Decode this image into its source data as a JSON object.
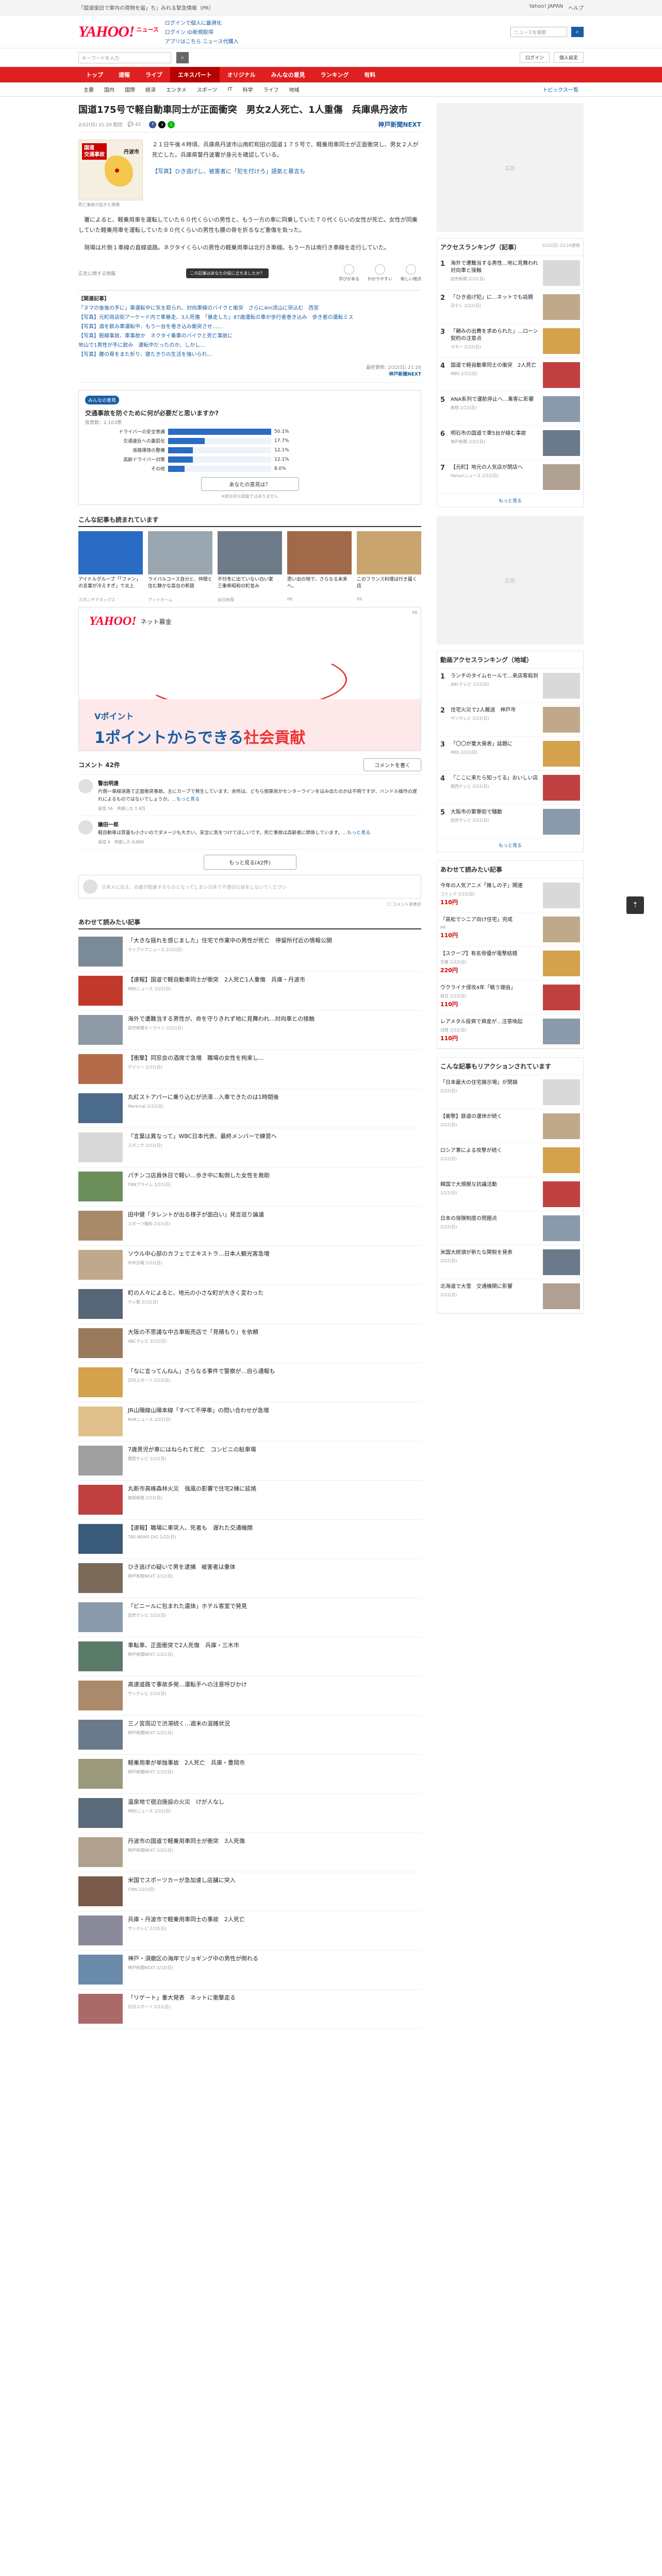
{
  "topbar": {
    "notice": "「国道復旧で車内の荷物を届」ち」みれる緊急情報（PR）",
    "right_links": [
      "Yahoo! JAPAN",
      "ヘルプ"
    ]
  },
  "header": {
    "logo": "YAHOO!",
    "logo_sub": "ニュース",
    "links": [
      "ログインで個人に最適化",
      "ログイン",
      "ID新規取得",
      "アプリはこちら",
      "ニュース代購入"
    ],
    "search_placeholder": "ニュースを検索"
  },
  "subrow": {
    "search_placeholder": "キーワードを入力",
    "buttons": [
      "ログイン",
      "個人設定"
    ]
  },
  "nav": {
    "items": [
      "トップ",
      "速報",
      "ライブ",
      "エキスパート",
      "オリジナル",
      "みんなの意見",
      "ランキング",
      "有料"
    ],
    "active": 3
  },
  "subnav": {
    "items": [
      "主要",
      "国内",
      "国際",
      "経済",
      "エンタメ",
      "スポーツ",
      "IT",
      "科学",
      "ライフ",
      "地域"
    ],
    "more": "トピックス一覧"
  },
  "article": {
    "title": "国道175号で軽自動車同士が正面衝突　男女2人死亡、1人重傷　兵庫県丹波市",
    "date": "2/22(日) 21:20 配信",
    "comments_meta": "42",
    "source": "神戸新聞NEXT",
    "thumb_badge": "国道\n交通事故",
    "thumb_place": "丹波市",
    "thumb_caption": "死亡事故が起きた現場",
    "lead": "２１日午後４時頃、兵庫県丹波市山南町和田の国道１７５号で、軽乗用車同士が正面衝突し、男女２人が死亡した。兵庫県警丹波署が身元を確認している。",
    "lead_link": "【写真】ひき逃げし、被害者に「犯を付けろ」語氣と暴言も",
    "p1": "署によると、軽乗用車を運転していた６０代くらいの男性と、もう一方の車に同乗していた７０代くらいの女性が死亡。女性が同乗していた軽乗用車を運転していた８０代くらいの男性も腰の骨を折るなど重傷を負った。",
    "p2": "現場は片側１車線の直線道路。ネクタイくらいの男性の軽乗用車は北行き車線。もう一方は南行き車線を走行していた。",
    "related_head": "【関連記事】",
    "related": [
      "「ヌマの後後の手に」車運転中に気を取られ、対向車線のバイクと衝突　さらに4ｍ流山に突込む　西宮",
      "【写真】元町商店街アーケード内で車暴走、3人死傷　「暴走した」87歳運転の車が歩行者巻き込み　歩き者の運転ミス",
      "【写真】酒を飲み車運転中、もう一台を巻き込み衝突させ……",
      "【写真】脱線事故、車事故か　ネクタイ乗車のバイクと死亡事故に",
      "地山で1男性が手に飲み　運転中だったのか、しかし…",
      "【写真】腰の骨をまた折り、寝たきりの生活を強いられ…"
    ],
    "copyright": "最終更新: 2/22(日) 21:20",
    "copyright_source": "神戸新聞NEXT"
  },
  "reactions": {
    "tooltip": "この記事はあなたの役に立ちましたか？",
    "items": [
      "学びがある",
      "わかりやすい",
      "新しい視点"
    ],
    "ad_note": "広告に関する情報"
  },
  "poll": {
    "tag": "みんなの意見",
    "question": "交通事故を防ぐために何が必要だと思いますか?",
    "sub": "投票数：2,103票",
    "options": [
      {
        "label": "ドライバーの安全意識",
        "pct": "50.1%",
        "value": 50.1
      },
      {
        "label": "交通違反への厳罰化",
        "pct": "17.7%",
        "value": 17.7
      },
      {
        "label": "道路環境の整備",
        "pct": "12.1%",
        "value": 12.1
      },
      {
        "label": "高齢ドライバー対策",
        "pct": "12.1%",
        "value": 12.1
      },
      {
        "label": "その他",
        "pct": "8.0%",
        "value": 8.0
      }
    ],
    "vote": "あなたの意見は？",
    "note": "※統計的な調査ではありません"
  },
  "recs": {
    "title": "こんな記事も読まれています",
    "items": [
      {
        "t": "アイドルグループ「「ファン」の言葉が冷えすぎ」で炎上",
        "s": "スポニチアネックス"
      },
      {
        "t": "ライバルコース自分と、仲間と住む静かな高台の新居",
        "s": "アットホーム"
      },
      {
        "t": "不付冬に出ていない白い家　三重県昭和の町並み",
        "s": "毎日新聞"
      },
      {
        "t": "思い出の地で、さらなる未来へ。",
        "s": "PR"
      },
      {
        "t": "このフランス料理は行き届く店",
        "s": "PR"
      }
    ]
  },
  "banner": {
    "ylogo": "YAHOO!",
    "bokin": "ネット募金",
    "ad": "PR",
    "line1": "Vポイント",
    "line2": "1ポイントからできる",
    "line2b": "社会貢献"
  },
  "comments": {
    "count": "コメント 42件",
    "write": "コメントを書く",
    "items": [
      {
        "name": "警出明遠",
        "text": "片側一車線道路で正面衝突事故。主にカーブで発生しています。余所は、どちら側車両がセンターラインをはみ出たのかは不明ですが、ハンドル操作の遅れによるものではないでしょうか。",
        "more": "…もっと見る",
        "acts": "返信 16　共感した 1.4万"
      },
      {
        "name": "鎌田一郎",
        "text": "軽自動車は質量も小さいのでダメージも大きい。安全に気をつけてほしいです。死亡事故は高齢者に関係しています。",
        "more": "…もっと見る",
        "acts": "返信 4　共感した 6,800"
      }
    ],
    "more_button": "もっと見る(42件)",
    "post_placeholder": "日本人に伝え、自粛が配慮するものとなってしまい日本で不適切な話をしないでください",
    "checkbox": "コメント非表示"
  },
  "more_list": {
    "title": "あわせて読みたい記事",
    "items": [
      {
        "t": "「大きな揺れを感じました」住宅で作業中の男性が死亡　停留所付近の情報公開",
        "s": "ライブドアニュース 2/22(日)"
      },
      {
        "t": "【速報】国道で軽自動車同士が衝突　2人死亡1人重傷　兵庫・丹波市",
        "s": "MBSニュース 2/22(日)"
      },
      {
        "t": "海外で遭難当する男性が、命を守りきれず地に見舞われ…対向車との接触",
        "s": "読売新聞オンライン 2/22(日)"
      },
      {
        "t": "【衝撃】同窓会の酒席で急増　職場の女性を拘束し…",
        "s": "デイリー 2/22(日)"
      },
      {
        "t": "丸紅ストアパーに乗り込むが渋滞…入車できたのは1時間後",
        "s": "Merkmal 2/22(日)"
      },
      {
        "t": "「言葉は異なって」WBC日本代表、最終メンバーで練習へ",
        "s": "スポニチ 2/22(日)"
      },
      {
        "t": "パチンコ店員休日で軽い…歩き中に転倒した女性を救助",
        "s": "FNNプライム 2/22(日)"
      },
      {
        "t": "田中健「タレントが出る様子が面白い」発言巡り論議",
        "s": "スポーツ報知 2/22(日)"
      },
      {
        "t": "ソウル中心部のカフェでエキストラ…日本人観光客急増",
        "s": "中央日報 2/22(日)"
      },
      {
        "t": "町の人々によると、地元の小さな町が大きく変わった",
        "s": "テレ朝 2/22(日)"
      },
      {
        "t": "大阪の不思議な中古車販売店で「見積もり」を依頼",
        "s": "ABCテレビ 2/22(日)"
      },
      {
        "t": "「なに言ってんねん」さらなる事件で警察が…自ら通報も",
        "s": "日刊スポーツ 2/22(日)"
      },
      {
        "t": "JR山陽線山陽本線「すべて不停車」の問い合わせが急増",
        "s": "NHKニュース 2/22(日)"
      },
      {
        "t": "7歳男児が車にはねられて死亡　コンビニの駐車場",
        "s": "関西テレビ 2/22(日)"
      },
      {
        "t": "丸新市高峰森林火災　強風の影響で住宅2棟に延焼",
        "s": "産経新聞 2/22(日)"
      },
      {
        "t": "【速報】職場に車突入、死者も　遅れた交通機関",
        "s": "TBS NEWS DIG 2/22(日)"
      },
      {
        "t": "ひき逃げの疑いで男を逮捕　被害者は重体",
        "s": "神戸新聞NEXT 2/22(日)"
      },
      {
        "t": "「ビニールに包まれた遺体」ホテル客室で発見",
        "s": "読売テレビ 2/22(日)"
      },
      {
        "t": "車転車、正面衝突で2人死傷　兵庫・三木市",
        "s": "神戸新聞NEXT 2/22(日)"
      },
      {
        "t": "高速道路で事故多発…運転手への注意呼びかけ",
        "s": "サンテレビ 2/22(日)"
      },
      {
        "t": "三ノ宮周辺で渋滞続く…週末の混雑状況",
        "s": "神戸新聞NEXT 2/22(日)"
      },
      {
        "t": "軽乗用車が単独事故　2人死亡　兵庫・豊岡市",
        "s": "神戸新聞NEXT 2/22(日)"
      },
      {
        "t": "温泉地で宿泊施設の火災　けが人なし",
        "s": "MBSニュース 2/22(日)"
      },
      {
        "t": "丹波市の国道で軽乗用車同士が衝突　3人死傷",
        "s": "神戸新聞NEXT 2/22(日)"
      },
      {
        "t": "米国でスポーツカーが急加速し店舗に突入",
        "s": "CNN 2/22(日)"
      },
      {
        "t": "兵庫・丹波市で軽乗用車同士の事故　2人死亡",
        "s": "サンテレビ 2/22(日)"
      },
      {
        "t": "神戸・須磨区の海岸でジョギング中の男性が倒れる",
        "s": "神戸新聞NEXT 2/22(日)"
      },
      {
        "t": "「リゲート」重大発表　ネットに衝撃走る",
        "s": "日刊スポーツ 2/22(日)"
      }
    ]
  },
  "side": {
    "ad_label": "広告",
    "rank1_title": "アクセスランキング（記事）",
    "rank1_note": "2/22(日) 23:10更新",
    "rank1": [
      {
        "t": "海外で遭難当する男性…地に見舞われ対向車と接触",
        "s": "読売新聞 2/22(日)"
      },
      {
        "t": "「ひき逃げ犯」に…ネットでも話題",
        "s": "日テレ 2/22(日)"
      },
      {
        "t": "「頼みの出費を求められた」…ローン契約の注意点",
        "s": "マネー 2/22(日)"
      },
      {
        "t": "国道で軽自動車同士の衝突　2人死亡",
        "s": "MBS 2/22(日)"
      },
      {
        "t": "ANA系列で運航停止へ…乗客に影響",
        "s": "産経 2/22(日)"
      },
      {
        "t": "明石市の国道で車5台が絡む事故",
        "s": "神戸新聞 2/22(日)"
      },
      {
        "t": "【元町】地元の人気店が閉店へ",
        "s": "Yahoo!ニュース 2/22(日)"
      }
    ],
    "rank2_title": "動画アクセスランキング（地域）",
    "rank2": [
      {
        "t": "ランチのタイムセールで…来店客殺到",
        "s": "ABCテレビ 2/22(日)"
      },
      {
        "t": "住宅火災で2人搬送　神戸市",
        "s": "サンテレビ 2/22(日)"
      },
      {
        "t": "「〇〇が重大発表」話題に",
        "s": "MBS 2/22(日)"
      },
      {
        "t": "「ここに来たら知ってる」おいしい店",
        "s": "関西テレビ 2/22(日)"
      },
      {
        "t": "大阪市の繁華街で騒動",
        "s": "読売テレビ 2/22(日)"
      }
    ],
    "rank3_title": "あわせて読みたい記事",
    "rank3": [
      {
        "t": "今年の人気アニメ「推しの子」関連",
        "s": "コミック 2/22(日)",
        "price": "110"
      },
      {
        "t": "「高松でシニア向け住宅」完成",
        "s": "PR",
        "price": "110"
      },
      {
        "t": "【スクープ】有名俳優が電撃結婚",
        "s": "文春 2/22(日)",
        "price": "220"
      },
      {
        "t": "ウクライナ侵攻4年「戦う理由」",
        "s": "毎日 2/22(日)",
        "price": "110"
      },
      {
        "t": "レアメタル投資で資産が…注意喚起",
        "s": "日経 2/22(日)",
        "price": "110"
      }
    ],
    "rank4_title": "こんな記事もリアクションされています",
    "rank4": [
      {
        "t": "「日本最大の住宅展示場」が閉鎖",
        "s": "2/22(日)"
      },
      {
        "t": "【衝撃】鉄道の運休が続く",
        "s": "2/22(日)"
      },
      {
        "t": "ロシア軍による攻撃が続く",
        "s": "2/22(日)"
      },
      {
        "t": "韓国で大規模な抗議活動",
        "s": "2/22(日)"
      },
      {
        "t": "日本の保険制度の問題点",
        "s": "2/22(日)"
      },
      {
        "t": "米国大統領が新たな関税を発表",
        "s": "2/22(日)"
      },
      {
        "t": "北海道で大雪　交通機関に影響",
        "s": "2/22(日)"
      }
    ],
    "more": "もっと見る"
  }
}
